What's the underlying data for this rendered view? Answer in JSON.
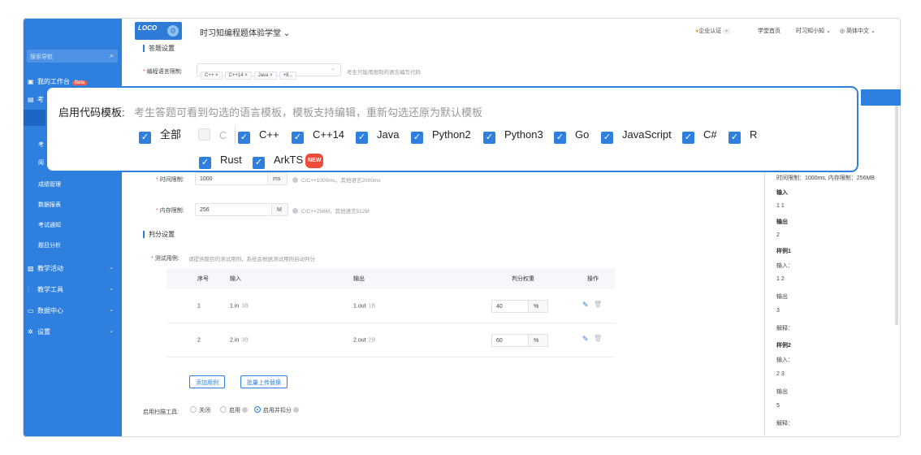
{
  "header": {
    "logo_text": "LOCO",
    "title": "时习知编程题体验学堂 ⌄",
    "enterprise_cert": "企业认证",
    "study_home": "学堂首页",
    "user": "时习知小知 ⌄",
    "language": "简体中文 ⌄"
  },
  "sidebar": {
    "search_placeholder": "搜索导航",
    "workbench": "我的工作台",
    "beta": "Beta",
    "exam": "考",
    "subs": [
      "考",
      "阅",
      "成绩管理",
      "数据报表",
      "考试通知",
      "题目分析"
    ],
    "groups": [
      "教学活动",
      "教学工具",
      "数据中心",
      "设置"
    ]
  },
  "form": {
    "section_top": "答题设置",
    "lang_limit_label": "编程语言限制:",
    "lang_tags": [
      "C++ ×",
      "C++14 ×",
      "Java ×",
      "+8..."
    ],
    "lang_limit_hint": "考生只能用限制的语言编写代码",
    "time_limit_label": "时间限制:",
    "time_limit_value": "1000",
    "time_unit": "ms",
    "time_hint": "C/C++1000ms，其他语言2000ms",
    "mem_limit_label": "内存限制:",
    "mem_limit_value": "256",
    "mem_unit": "M",
    "mem_hint": "C/C++256M，其他语言512M",
    "section_judge": "判分设置",
    "testcase_label": "测试用例:",
    "testcase_hint": "请提供题目的测试用例，系统会根据测试用例自动判分",
    "add_case": "添加用例",
    "batch_upload": "批量上传替换",
    "scan_label": "启用扫描工具:",
    "scan_off": "关闭",
    "scan_on": "启用",
    "scan_on_deduct": "启用并扣分"
  },
  "table": {
    "headers": [
      "序号",
      "输入",
      "输出",
      "判分权重",
      "操作"
    ],
    "rows": [
      {
        "no": "1",
        "input": "1.in",
        "in_size": "3B",
        "output": "1.out",
        "out_size": "1B",
        "weight": "40",
        "unit": "%"
      },
      {
        "no": "2",
        "input": "2.in",
        "in_size": "3B",
        "output": "2.out",
        "out_size": "2B",
        "weight": "60",
        "unit": "%"
      }
    ]
  },
  "preview": {
    "limits": "时间限制：1000ms, 内存限制：256MB",
    "in_title": "输入",
    "in_val": "1 1",
    "out_title": "输出",
    "out_val": "2",
    "ex1": "样例1",
    "ex1_in": "输入：",
    "ex1_in_val": "1 2",
    "ex1_out": "输出",
    "ex1_out_val": "3",
    "ex1_exp": "解释：",
    "ex2": "样例2",
    "ex2_in": "输入：",
    "ex2_in_val": "2 3",
    "ex2_out": "输出",
    "ex2_out_val": "5",
    "ex2_exp": "解释："
  },
  "overlay": {
    "title": "启用代码模板:",
    "description": "考生答题可看到勾选的语言模板，模板支持编辑，重新勾选还原为默认模板",
    "all": "全部",
    "languages": [
      "C",
      "C++",
      "C++14",
      "Java",
      "Python2",
      "Python3",
      "Go",
      "JavaScript",
      "C#",
      "R",
      "Rust",
      "ArkTS"
    ],
    "new_badge": "NEW"
  },
  "colors": {
    "accent": "#2f7fde",
    "sidebar": "#2f7fde",
    "required": "#f04b3a"
  }
}
